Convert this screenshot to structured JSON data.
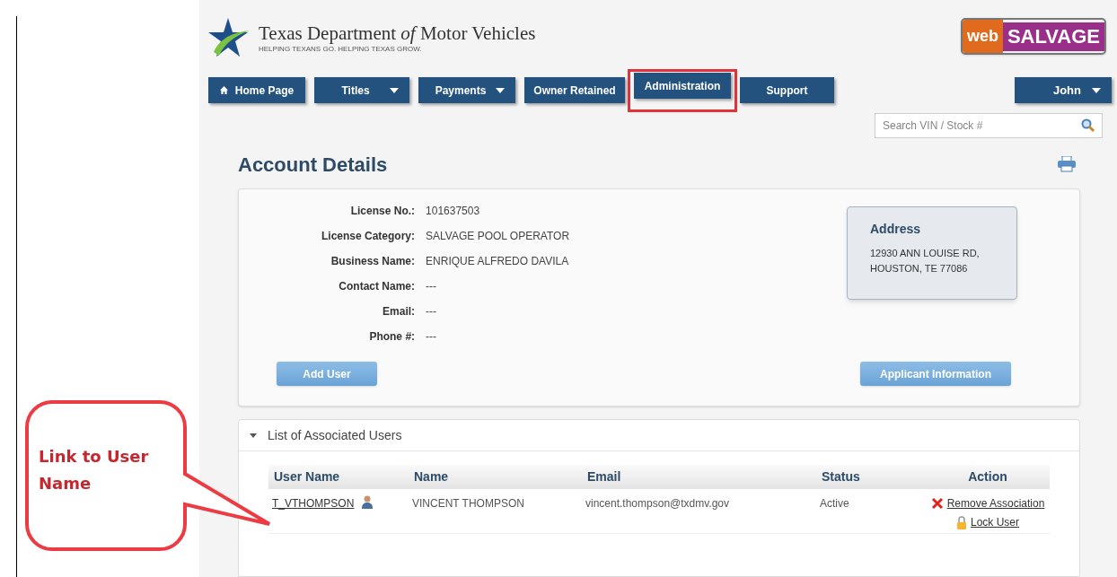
{
  "header": {
    "org_title": "Texas Department *of* Motor Vehicles",
    "org_tagline": "HELPING TEXANS GO. HELPING TEXAS GROW.",
    "brand_prefix": "web",
    "brand_name": "SALVAGE"
  },
  "nav": [
    {
      "label": "Home Page",
      "kind": "home",
      "highlighted": false
    },
    {
      "label": "Titles",
      "kind": "dropdown",
      "highlighted": false
    },
    {
      "label": "Payments",
      "kind": "dropdown",
      "highlighted": false
    },
    {
      "label": "Owner Retained",
      "kind": "plain",
      "highlighted": false
    },
    {
      "label": "Administration",
      "kind": "plain",
      "highlighted": true
    },
    {
      "label": "Support",
      "kind": "plain",
      "highlighted": false
    }
  ],
  "user_menu": {
    "label": "John"
  },
  "search": {
    "placeholder": "Search VIN / Stock #"
  },
  "page_title": "Account Details",
  "details": [
    {
      "label": "License No.:",
      "value": "101637503"
    },
    {
      "label": "License Category:",
      "value": "SALVAGE POOL OPERATOR"
    },
    {
      "label": "Business Name:",
      "value": "ENRIQUE ALFREDO DAVILA"
    },
    {
      "label": "Contact Name:",
      "value": "---"
    },
    {
      "label": "Email:",
      "value": "---"
    },
    {
      "label": "Phone #:",
      "value": "---"
    }
  ],
  "address": {
    "title": "Address",
    "lines": [
      "12930 ANN LOUISE RD,",
      "HOUSTON, TE 77086"
    ]
  },
  "buttons": [
    "Add User",
    "Applicant Information"
  ],
  "users_panel": {
    "title": "List of Associated Users",
    "expanded": true,
    "columns": [
      "User Name",
      "Name",
      "Email",
      "Status",
      "Action"
    ],
    "rows": [
      {
        "user_name": "T_VTHOMPSON",
        "name": "VINCENT THOMPSON",
        "email": "vincent.thompson@txdmv.gov",
        "status": "Active",
        "actions": [
          "Remove Association",
          "Lock User"
        ]
      }
    ]
  },
  "callout": {
    "text": "Link to User Name"
  }
}
